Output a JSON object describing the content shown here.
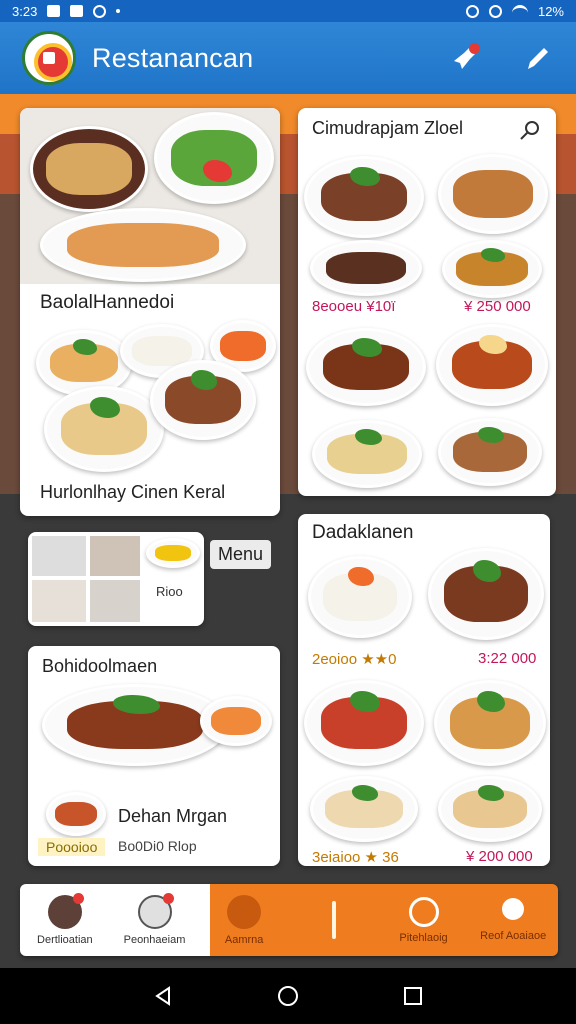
{
  "status_bar": {
    "time": "3:23",
    "battery": "12%"
  },
  "app_bar": {
    "title": "Restanancan"
  },
  "panels": {
    "top_left": {
      "caption_top": "BaolalHannedoi",
      "caption_bottom": "Hurlonlhay Cinen Keral"
    },
    "small_card": {
      "item_label": "Rioo",
      "menu_label": "Menu"
    },
    "bottom_left": {
      "title": "Bohidoolmaen",
      "subtitle": "Dehan Mrgan",
      "tag": "Poooioo",
      "caption": "Bo0Di0 Rlop"
    },
    "top_right": {
      "title": "Cimudrapjam Zloel",
      "left_note": "8eooeu ¥10ï",
      "price": "¥ 250 000"
    },
    "bottom_right": {
      "title": "Dadaklanen",
      "rating_text": "2eoioo ★★0",
      "price_1": "3:22 000",
      "rating_bottom": "3eiaioo ★ 36",
      "price_2": "¥ 200 000"
    }
  },
  "bottom_nav": {
    "items": [
      {
        "label": "Dertlioatian"
      },
      {
        "label": "Peonhaeiam"
      },
      {
        "label": "Aamrna"
      },
      {
        "label": ""
      },
      {
        "label": "Pitehlaoig"
      },
      {
        "label": "Reof Aoaiaoe"
      }
    ]
  },
  "colors": {
    "primary": "#1f74c8",
    "accent": "#ef7d1f",
    "badge": "#e53935",
    "price": "#c2185b"
  }
}
